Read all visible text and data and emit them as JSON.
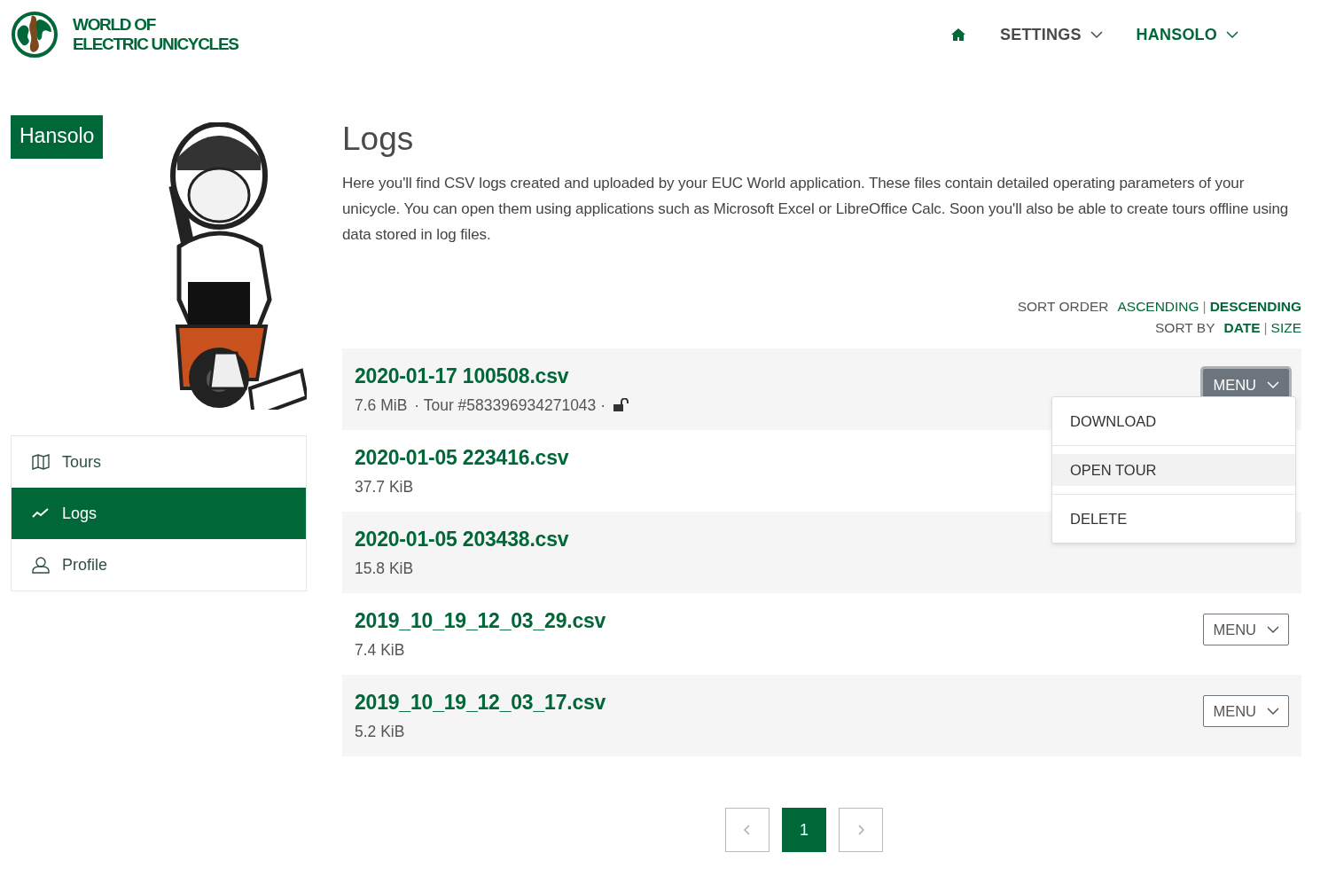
{
  "header": {
    "logo_lines": [
      "WORLD OF",
      "ELECTRIC UNICYCLES"
    ],
    "nav": [
      {
        "kind": "home"
      },
      {
        "kind": "dropdown",
        "label": "SETTINGS",
        "selected": false
      },
      {
        "kind": "dropdown",
        "label": "HANSOLO",
        "selected": true
      }
    ]
  },
  "sidebar": {
    "user": "Hansolo",
    "items": [
      {
        "kind": "map",
        "label": "Tours",
        "selected": false
      },
      {
        "kind": "chart",
        "label": "Logs",
        "selected": true
      },
      {
        "kind": "user",
        "label": "Profile",
        "selected": false
      }
    ]
  },
  "content": {
    "title": "Logs",
    "description": "Here you'll find CSV logs created and uploaded by your EUC World application. These files contain detailed operating parameters of your unicycle. You can open them using applications such as Microsoft Excel or LibreOffice Calc. Soon you'll also be able to create tours offline using data stored in log files.",
    "sort_order": {
      "label": "SORT ORDER",
      "separator": "|",
      "options": [
        {
          "label": "ASCENDING",
          "selected": false
        },
        {
          "label": "DESCENDING",
          "selected": true
        }
      ]
    },
    "sort_by": {
      "label": "SORT BY",
      "separator": "|",
      "options": [
        {
          "label": "DATE",
          "selected": true
        },
        {
          "label": "SIZE",
          "selected": false
        }
      ]
    },
    "logs": [
      {
        "name": "2020-01-17 100508.csv",
        "size": "7.6 MiB",
        "tour": "· Tour #583396934271043 ·",
        "locked": false,
        "menu": {
          "label": "MENU",
          "open": true,
          "items": [
            {
              "label": "DOWNLOAD",
              "selected": false
            },
            {
              "label": "OPEN TOUR",
              "selected": true
            },
            {
              "label": "DELETE",
              "selected": false
            }
          ]
        }
      },
      {
        "name": "2020-01-05 223416.csv",
        "size": "37.7 KiB"
      },
      {
        "name": "2020-01-05 203438.csv",
        "size": "15.8 KiB"
      },
      {
        "name": "2019_10_19_12_03_29.csv",
        "size": "7.4 KiB",
        "menu": {
          "label": "MENU",
          "open": false
        }
      },
      {
        "name": "2019_10_19_12_03_17.csv",
        "size": "5.2 KiB",
        "menu": {
          "label": "MENU",
          "open": false
        }
      }
    ],
    "pagination": {
      "pages": [
        {
          "label": "1",
          "selected": true
        }
      ]
    }
  }
}
